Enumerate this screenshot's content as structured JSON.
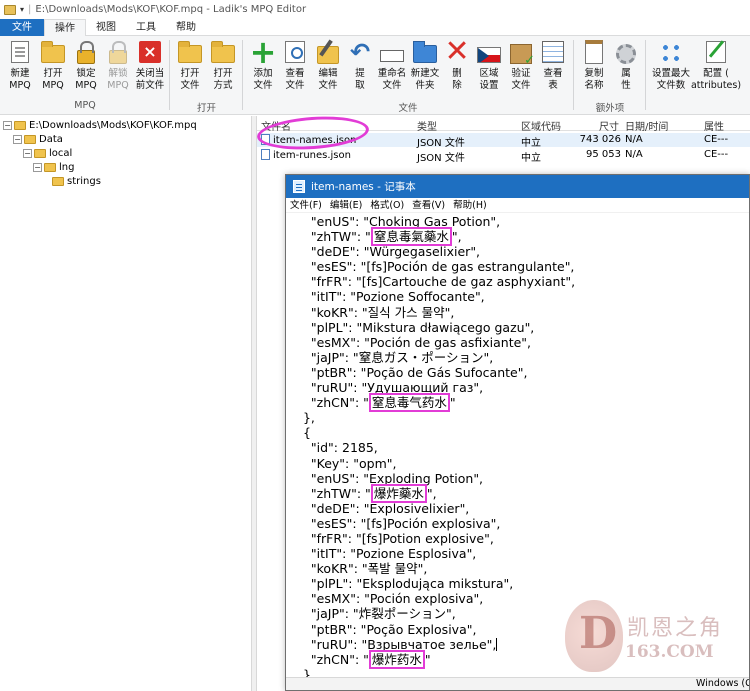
{
  "window": {
    "title": "E:\\Downloads\\Mods\\KOF\\KOF.mpq - Ladik's MPQ Editor"
  },
  "tabs": [
    "文件",
    "操作",
    "视图",
    "工具",
    "帮助"
  ],
  "ribbon": {
    "groups": [
      {
        "label": "MPQ",
        "buttons": [
          "新建\nMPQ",
          "打开\nMPQ",
          "锁定\nMPQ",
          "解锁\nMPQ",
          "关闭当\n前文件"
        ]
      },
      {
        "label": "打开",
        "buttons": [
          "打开\n文件",
          "打开\n方式"
        ]
      },
      {
        "label": "文件",
        "buttons": [
          "添加\n文件",
          "查看\n文件",
          "编辑\n文件",
          "提\n取",
          "重命名\n文件",
          "新建文\n件夹",
          "删\n除",
          "区域\n设置",
          "验证\n文件",
          "查看\n表"
        ]
      },
      {
        "label": "额外项",
        "buttons": [
          "复制\n名称",
          "属\n性"
        ]
      },
      {
        "label": "",
        "buttons": [
          "设置最大\n文件数",
          "配置 (\nattributes)"
        ]
      }
    ],
    "icons": [
      "new-mpq-icon",
      "open-mpq-icon",
      "lock-icon",
      "unlock-icon",
      "close-file-icon",
      "open-file-icon",
      "open-with-icon",
      "add-file-icon",
      "view-file-icon",
      "edit-file-icon",
      "extract-icon",
      "rename-icon",
      "new-folder-icon",
      "delete-icon",
      "locale-icon",
      "verify-icon",
      "view-table-icon",
      "copy-name-icon",
      "properties-icon",
      "max-files-icon",
      "attributes-icon"
    ]
  },
  "tree": {
    "items": [
      {
        "label": "E:\\Downloads\\Mods\\KOF\\KOF.mpq",
        "depth": 0
      },
      {
        "label": "Data",
        "depth": 1
      },
      {
        "label": "local",
        "depth": 2
      },
      {
        "label": "lng",
        "depth": 3
      },
      {
        "label": "strings",
        "depth": 4
      }
    ]
  },
  "filelist": {
    "columns": [
      "文件名",
      "类型",
      "区域代码",
      "尺寸",
      "日期/时间",
      "属性"
    ],
    "rows": [
      [
        "item-names.json",
        "JSON 文件",
        "中立",
        "743 026",
        "N/A",
        "CE---"
      ],
      [
        "item-runes.json",
        "JSON 文件",
        "中立",
        "95 053",
        "N/A",
        "CE---"
      ]
    ]
  },
  "notepad": {
    "title": "item-names - 记事本",
    "menu": [
      "文件(F)",
      "编辑(E)",
      "格式(O)",
      "查看(V)",
      "帮助(H)"
    ],
    "lines": [
      {
        "k": "    \"enUS\": \"",
        "v": "Choking Gas Potion",
        "e": "\",",
        "hl": false
      },
      {
        "k": "    \"zhTW\": \"",
        "v": "窒息毒氣藥水",
        "e": "\",",
        "hl": true
      },
      {
        "k": "    \"deDE\": \"",
        "v": "Würgegaselixier",
        "e": "\",",
        "hl": false
      },
      {
        "k": "    \"esES\": \"",
        "v": "[fs]Poción de gas estrangulante",
        "e": "\",",
        "hl": false
      },
      {
        "k": "    \"frFR\": \"",
        "v": "[fs]Cartouche de gaz asphyxiant",
        "e": "\",",
        "hl": false
      },
      {
        "k": "    \"itIT\": \"",
        "v": "Pozione Soffocante",
        "e": "\",",
        "hl": false
      },
      {
        "k": "    \"koKR\": \"",
        "v": "질식 가스 물약",
        "e": "\",",
        "hl": false
      },
      {
        "k": "    \"plPL\": \"",
        "v": "Mikstura dławiącego gazu",
        "e": "\",",
        "hl": false
      },
      {
        "k": "    \"esMX\": \"",
        "v": "Poción de gas asfixiante",
        "e": "\",",
        "hl": false
      },
      {
        "k": "    \"jaJP\": \"",
        "v": "窒息ガス・ポーション",
        "e": "\",",
        "hl": false
      },
      {
        "k": "    \"ptBR\": \"",
        "v": "Poção de Gás Sufocante",
        "e": "\",",
        "hl": false
      },
      {
        "k": "    \"ruRU\": \"",
        "v": "Удушающий газ",
        "e": "\",",
        "hl": false
      },
      {
        "k": "    \"zhCN\": \"",
        "v": "窒息毒气药水",
        "e": "\"",
        "hl": true
      },
      {
        "k": "  },",
        "v": "",
        "e": "",
        "hl": false
      },
      {
        "k": "  {",
        "v": "",
        "e": "",
        "hl": false
      },
      {
        "k": "    \"id\": 2185,",
        "v": "",
        "e": "",
        "hl": false
      },
      {
        "k": "    \"Key\": \"",
        "v": "opm",
        "e": "\",",
        "hl": false
      },
      {
        "k": "    \"enUS\": \"",
        "v": "Exploding Potion",
        "e": "\",",
        "hl": false
      },
      {
        "k": "    \"zhTW\": \"",
        "v": "爆炸藥水",
        "e": "\",",
        "hl": true
      },
      {
        "k": "    \"deDE\": \"",
        "v": "Explosivelixier",
        "e": "\",",
        "hl": false
      },
      {
        "k": "    \"esES\": \"",
        "v": "[fs]Poción explosiva",
        "e": "\",",
        "hl": false
      },
      {
        "k": "    \"frFR\": \"",
        "v": "[fs]Potion explosive",
        "e": "\",",
        "hl": false
      },
      {
        "k": "    \"itIT\": \"",
        "v": "Pozione Esplosiva",
        "e": "\",",
        "hl": false
      },
      {
        "k": "    \"koKR\": \"",
        "v": "폭발 물약",
        "e": "\",",
        "hl": false
      },
      {
        "k": "    \"plPL\": \"",
        "v": "Eksplodująca mikstura",
        "e": "\",",
        "hl": false
      },
      {
        "k": "    \"esMX\": \"",
        "v": "Poción explosiva",
        "e": "\",",
        "hl": false
      },
      {
        "k": "    \"jaJP\": \"",
        "v": "炸裂ポーション",
        "e": "\",",
        "hl": false
      },
      {
        "k": "    \"ptBR\": \"",
        "v": "Poção Explosiva",
        "e": "\",",
        "hl": false
      },
      {
        "k": "    \"ruRU\": \"",
        "v": "Взрывчатое зелье",
        "e": "\",",
        "hl": false
      },
      {
        "k": "    \"zhCN\": \"",
        "v": "爆炸药水",
        "e": "\"",
        "hl": true
      },
      {
        "k": "  }",
        "v": "",
        "e": "",
        "hl": false
      }
    ],
    "status": "Windows (C"
  },
  "watermark": {
    "letter": "D",
    "line1": "凯恩之角",
    "line2": "163.COM"
  },
  "colors": {
    "accent": "#1e6fc1",
    "annotation": "#e23cd6"
  }
}
